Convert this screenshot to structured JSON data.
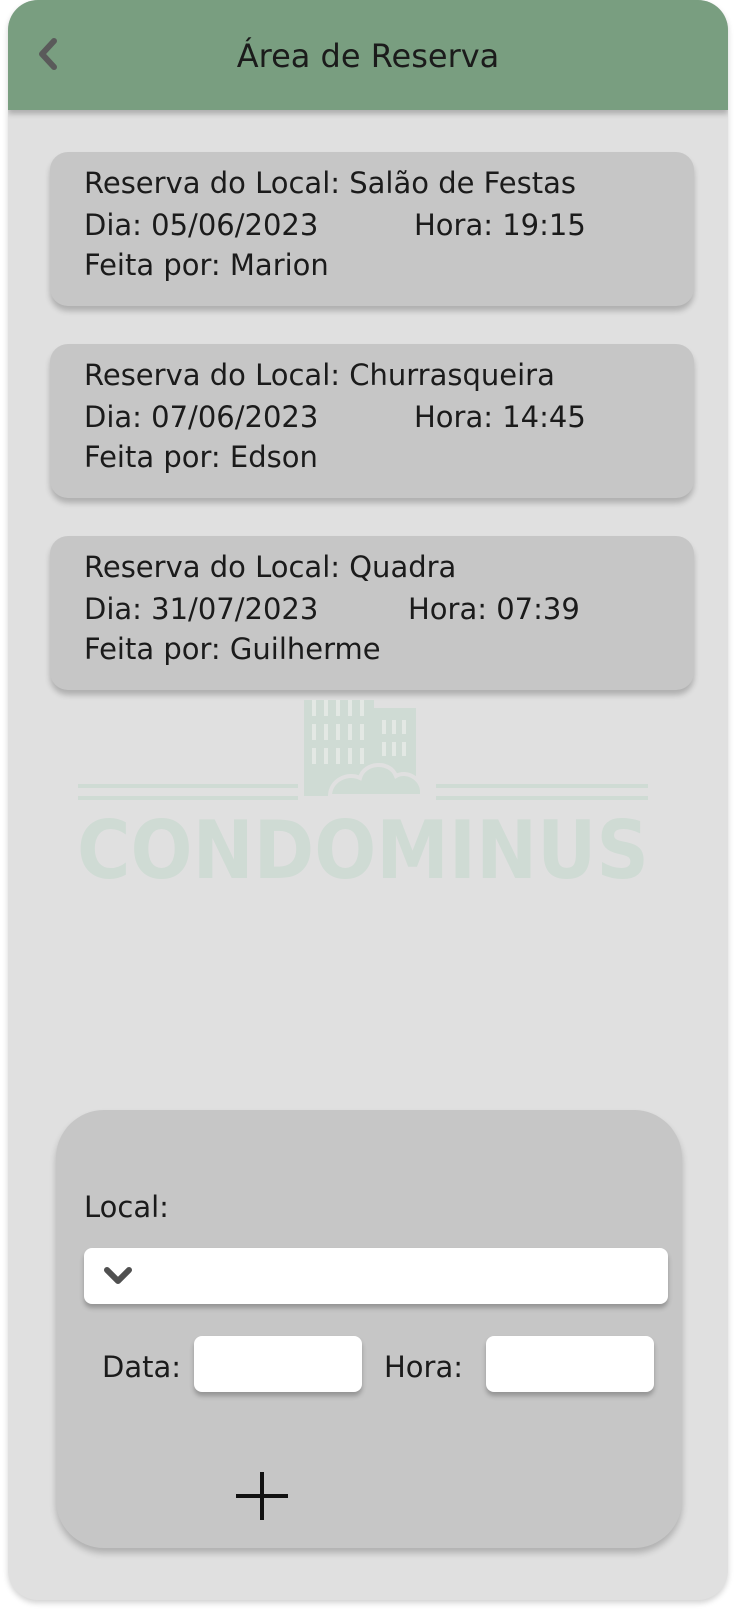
{
  "header": {
    "title": "Área de Reserva",
    "back_icon": "chevron-left-icon",
    "background_color": "#799e80"
  },
  "reservations": [
    {
      "local_label": "Reserva do Local: Salão de Festas",
      "date_label": "Dia: 05/06/2023",
      "time_label": "Hora: 19:15",
      "by_label": "Feita por: Marion"
    },
    {
      "local_label": "Reserva do Local: Churrasqueira",
      "date_label": "Dia: 07/06/2023",
      "time_label": "Hora: 14:45",
      "by_label": "Feita por: Edson"
    },
    {
      "local_label": "Reserva do Local: Quadra",
      "date_label": "Dia: 31/07/2023",
      "time_label": "Hora: 07:39",
      "by_label": "Feita por: Guilherme"
    }
  ],
  "watermark": {
    "text": "CONDOMINUS",
    "icon": "building-icon",
    "color": "#cfdbd4"
  },
  "form": {
    "local_label": "Local:",
    "local_value": "",
    "dropdown_icon": "chevron-down-icon",
    "date_label": "Data:",
    "date_value": "",
    "time_label": "Hora:",
    "time_value": "",
    "add_icon": "plus-icon"
  },
  "colors": {
    "background": "#e0e0e0",
    "card": "#c6c6c6",
    "text": "#1b1b1b"
  }
}
